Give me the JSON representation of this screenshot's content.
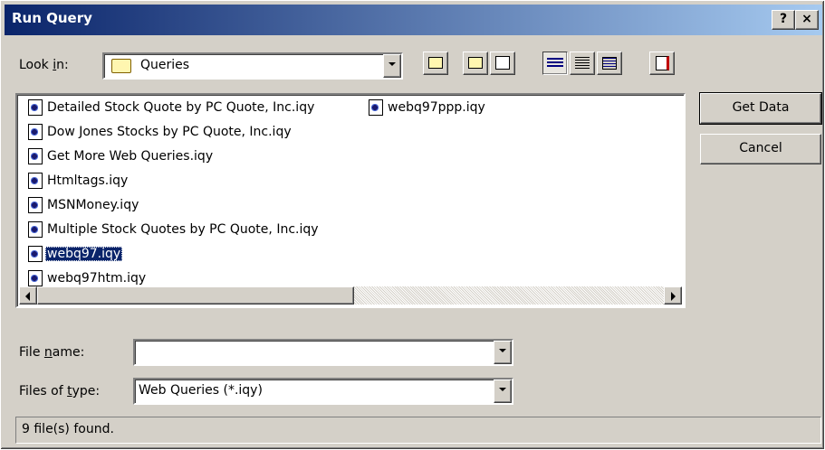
{
  "window": {
    "title": "Run Query",
    "help_button": "?",
    "close_button": "×"
  },
  "look_in": {
    "label_pre": "Look ",
    "label_mnemonic": "i",
    "label_post": "n:",
    "value": "Queries"
  },
  "toolbar": {
    "up_one_level": "up-folder-icon",
    "new_folder": "new-folder-icon",
    "create_new_folder": "create-folder-icon",
    "list_view": "list-view-icon",
    "details_view": "details-view-icon",
    "properties_view": "properties-view-icon",
    "commands": "commands-icon"
  },
  "files": [
    {
      "name": "Detailed Stock Quote by PC Quote, Inc.iqy",
      "selected": false
    },
    {
      "name": "Dow Jones Stocks by PC Quote, Inc.iqy",
      "selected": false
    },
    {
      "name": "Get More Web Queries.iqy",
      "selected": false
    },
    {
      "name": "Htmltags.iqy",
      "selected": false
    },
    {
      "name": "MSNMoney.iqy",
      "selected": false
    },
    {
      "name": "Multiple Stock Quotes by PC Quote, Inc.iqy",
      "selected": false
    },
    {
      "name": "webq97.iqy",
      "selected": true
    },
    {
      "name": "webq97htm.iqy",
      "selected": false
    },
    {
      "name": "webq97ppp.iqy",
      "selected": false
    }
  ],
  "buttons": {
    "get_data": "Get Data",
    "cancel": "Cancel"
  },
  "file_name": {
    "label_pre": "File ",
    "label_mnemonic": "n",
    "label_post": "ame:",
    "value": ""
  },
  "files_of_type": {
    "label_pre": "Files of ",
    "label_mnemonic": "t",
    "label_post": "ype:",
    "value": "Web Queries (*.iqy)"
  },
  "status": "9 file(s) found."
}
